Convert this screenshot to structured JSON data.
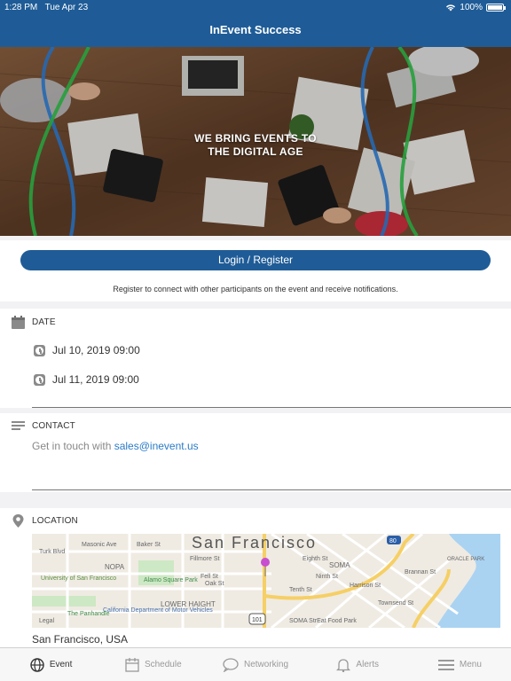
{
  "status_bar": {
    "time": "1:28 PM",
    "date": "Tue Apr 23",
    "battery": "100%",
    "battery_level": 1.0
  },
  "nav": {
    "title": "InEvent Success"
  },
  "hero": {
    "tagline_line1": "WE BRING EVENTS TO",
    "tagline_line2": "THE DIGITAL AGE"
  },
  "login": {
    "button_label": "Login / Register",
    "note": "Register to connect with other participants on the event and receive notifications."
  },
  "date_section": {
    "title": "DATE",
    "icon": "calendar-icon",
    "entries": [
      "Jul 10, 2019 09:00",
      "Jul 11, 2019 09:00"
    ]
  },
  "contact_section": {
    "title": "CONTACT",
    "icon": "lines-icon",
    "text_prefix": "Get in touch with ",
    "email": "sales@inevent.us"
  },
  "location_section": {
    "title": "LOCATION",
    "icon": "pin-icon",
    "map": {
      "city_label": "San Francisco",
      "labels": [
        "Turk Blvd",
        "NOPA",
        "University of San Francisco",
        "Alamo Square Park",
        "Fell St",
        "Oak St",
        "California Department of Motor Vehicles",
        "LOWER HAIGHT",
        "The Panhandle",
        "SOMA",
        "SOMA StrEat Food Park",
        "ORACLE PARK",
        "Townsend St",
        "Brannan St",
        "Harrison St",
        "Eighth St",
        "Ninth St",
        "Tenth St",
        "Fillmore St",
        "Masonic Ave",
        "Baker St",
        "Legal",
        "101",
        "80"
      ]
    },
    "address": "San Francisco, USA"
  },
  "tabs": [
    {
      "label": "Event",
      "icon": "globe-icon",
      "active": true
    },
    {
      "label": "Schedule",
      "icon": "calendar-icon",
      "active": false
    },
    {
      "label": "Networking",
      "icon": "chat-bubble-icon",
      "active": false
    },
    {
      "label": "Alerts",
      "icon": "bell-icon",
      "active": false
    },
    {
      "label": "Menu",
      "icon": "hamburger-icon",
      "active": false
    }
  ],
  "colors": {
    "brand": "#1f5c97",
    "link": "#2a7bc8",
    "section_bg": "#f2f2f4"
  }
}
